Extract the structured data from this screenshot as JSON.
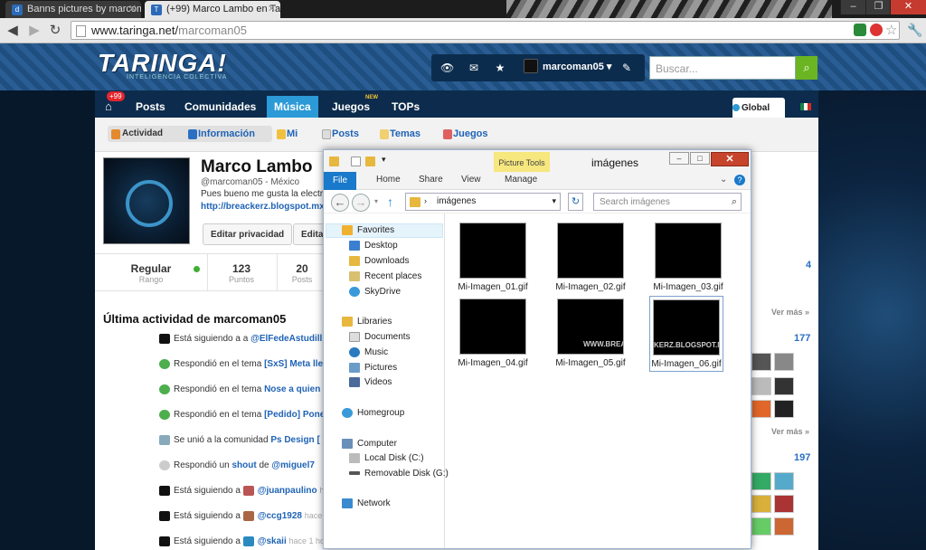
{
  "browser": {
    "tabs": [
      {
        "title": "Banns pictures by marcoma",
        "icon": "deviantart-icon"
      },
      {
        "title": "(+99) Marco Lambo en Tar",
        "icon": "taringa-icon"
      }
    ],
    "url_host": "www.taringa.net/",
    "url_path": "marcoman05"
  },
  "site": {
    "logo": "TARINGA!",
    "logo_sub": "INTELIGENCIA COLECTIVA",
    "username": "marcoman05",
    "search_placeholder": "Buscar...",
    "nav": [
      {
        "label": "Posts"
      },
      {
        "label": "Comunidades"
      },
      {
        "label": "Música"
      },
      {
        "label": "Juegos"
      },
      {
        "label": "TOPs"
      }
    ],
    "badge": "+99",
    "new_label": "NEW",
    "global_label": "Global",
    "subnav": [
      {
        "label": "Actividad"
      },
      {
        "label": "Información"
      },
      {
        "label": "Mi"
      },
      {
        "label": "Posts"
      },
      {
        "label": "Temas"
      },
      {
        "label": "Juegos"
      }
    ]
  },
  "profile": {
    "name": "Marco Lambo",
    "handle": "@marcoman05 - México",
    "bio": "Pues bueno me gusta la electr",
    "blog": "http://breackerz.blogspot.mx",
    "edit_privacy": "Editar privacidad",
    "edit_other": "Edita",
    "rank_value": "Regular",
    "rank_label": "Rango",
    "points_value": "123",
    "points_label": "Puntos",
    "posts_value": "20",
    "posts_label": "Posts"
  },
  "activity": {
    "title": "Última actividad de marcoman05",
    "items": [
      {
        "pre": "Está siguiendo a",
        "link": "@ElFedeAstudill",
        "time": ""
      },
      {
        "pre": "Respondió en el tema",
        "link": "[SxS] Meta lle",
        "time": ""
      },
      {
        "pre": "Respondió en el tema",
        "link": "Nose a quien",
        "time": ""
      },
      {
        "pre": "Respondió en el tema",
        "link": "[Pedido] Pone",
        "time": ""
      },
      {
        "pre": "Se unió a la comunidad",
        "link": "Ps Design [",
        "time": ""
      },
      {
        "pre": "Respondió un",
        "link": "shout",
        "mid": "de",
        "link2": "@miguel7",
        "time": ""
      },
      {
        "pre": "Está siguiendo a",
        "link": "@juanpaulino",
        "time": "ha"
      },
      {
        "pre": "Está siguiendo a",
        "link": "@ccg1928",
        "time": "hace"
      },
      {
        "pre": "Está siguiendo a",
        "link": "@skaii",
        "time": "hace 1 ho"
      }
    ]
  },
  "sidebar": {
    "num1": "4",
    "num2": "177",
    "num3": "197",
    "ver_mas": "Ver más »"
  },
  "explorer": {
    "title": "imágenes",
    "picture_tools": "Picture Tools",
    "ribbon_tabs": [
      "File",
      "Home",
      "Share",
      "View",
      "Manage"
    ],
    "address": "imágenes",
    "search_placeholder": "Search imágenes",
    "nav": {
      "favorites": "Favorites",
      "desktop": "Desktop",
      "downloads": "Downloads",
      "recent": "Recent places",
      "skydrive": "SkyDrive",
      "libraries": "Libraries",
      "documents": "Documents",
      "music": "Music",
      "pictures": "Pictures",
      "videos": "Videos",
      "homegroup": "Homegroup",
      "computer": "Computer",
      "localdisk": "Local Disk (C:)",
      "removable": "Removable Disk (G:)",
      "network": "Network"
    },
    "files": [
      {
        "name": "Mi-Imagen_01.gif",
        "watermark": ""
      },
      {
        "name": "Mi-Imagen_02.gif",
        "watermark": ""
      },
      {
        "name": "Mi-Imagen_03.gif",
        "watermark": ""
      },
      {
        "name": "Mi-Imagen_04.gif",
        "watermark": ""
      },
      {
        "name": "Mi-Imagen_05.gif",
        "watermark": "WWW.BREA"
      },
      {
        "name": "Mi-Imagen_06.gif",
        "watermark": "KERZ.BLOGSPOT.MX"
      }
    ]
  },
  "colors": {
    "accent": "#2b9ad6",
    "link": "#1f63b5",
    "search_button": "#6ab521",
    "file_tab": "#1979ca"
  }
}
